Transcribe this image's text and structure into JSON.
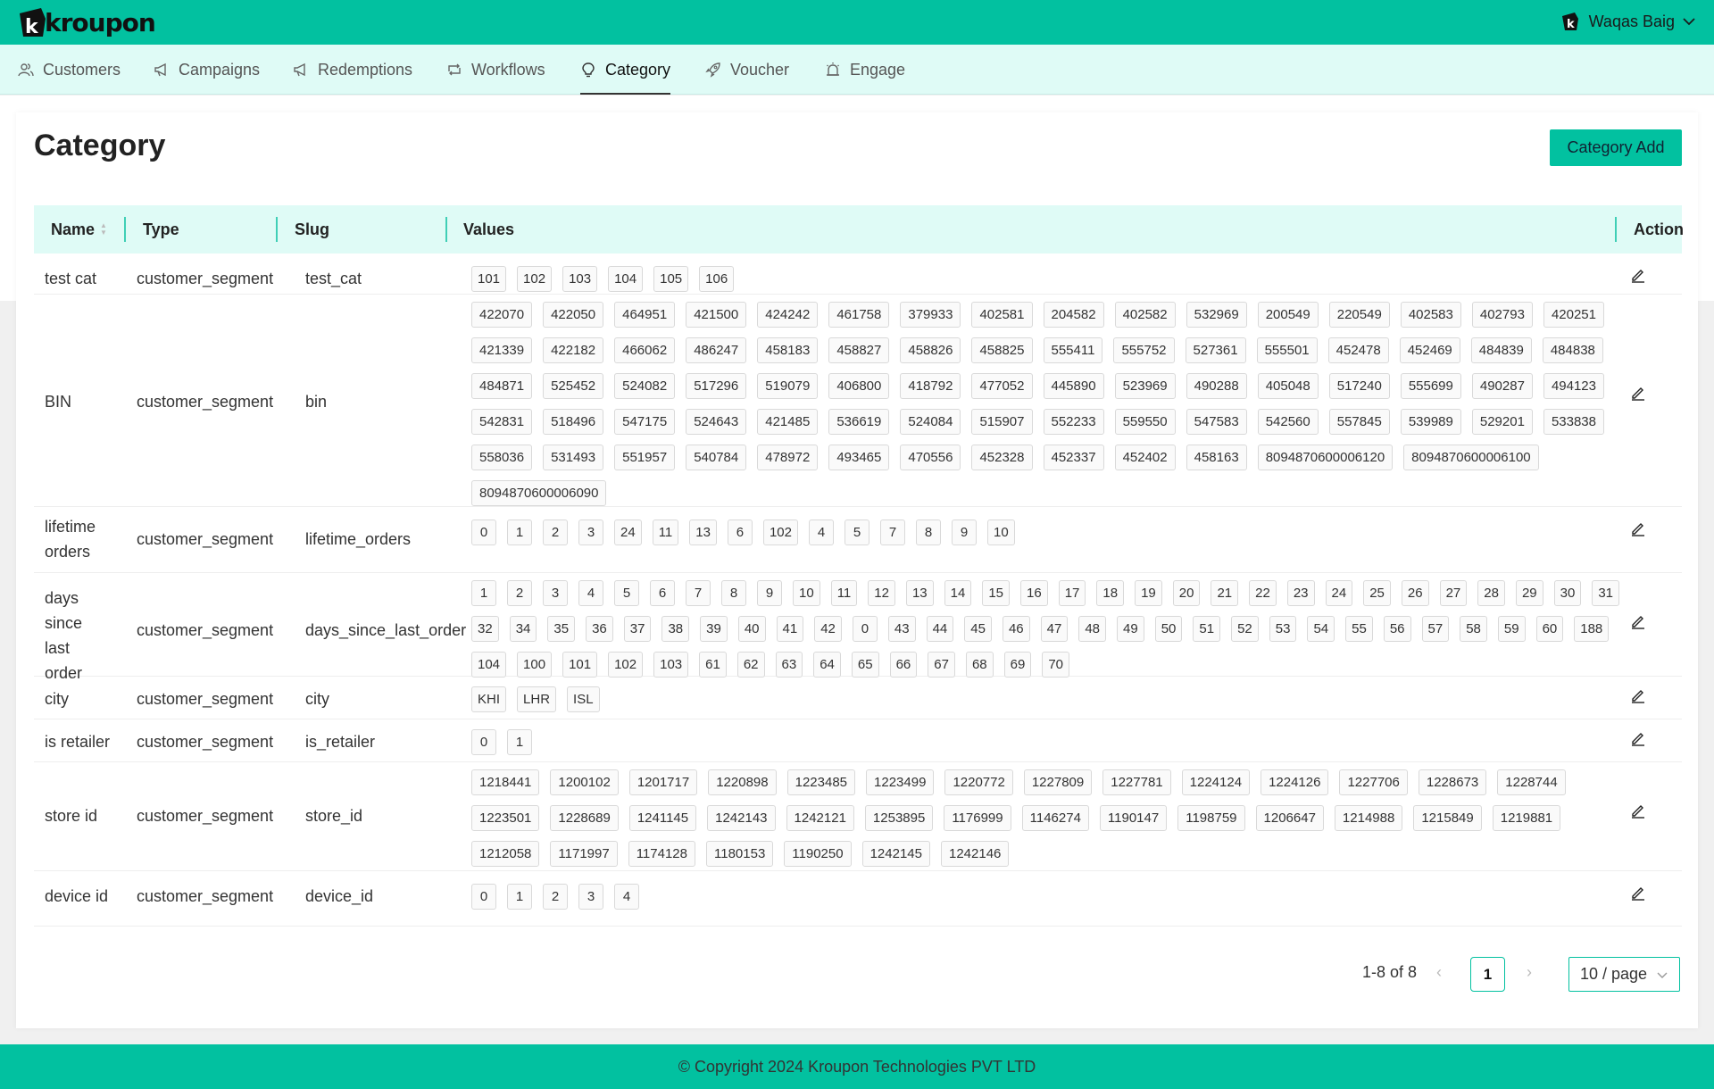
{
  "header": {
    "logo_text": "kroupon",
    "user_name": "Waqas Baig"
  },
  "nav": {
    "items": [
      {
        "label": "Customers"
      },
      {
        "label": "Campaigns"
      },
      {
        "label": "Redemptions"
      },
      {
        "label": "Workflows"
      },
      {
        "label": "Category"
      },
      {
        "label": "Voucher"
      },
      {
        "label": "Engage"
      }
    ],
    "active": "Category"
  },
  "page": {
    "title": "Category",
    "add_button": "Category Add"
  },
  "table": {
    "columns": {
      "name": "Name",
      "type": "Type",
      "slug": "Slug",
      "values": "Values",
      "action": "Action"
    },
    "rows": [
      {
        "name": "test cat",
        "type": "customer_segment",
        "slug": "test_cat",
        "values": [
          "101",
          "102",
          "103",
          "104",
          "105",
          "106"
        ]
      },
      {
        "name": "BIN",
        "type": "customer_segment",
        "slug": "bin",
        "values": [
          "422070",
          "422050",
          "464951",
          "421500",
          "424242",
          "461758",
          "379933",
          "402581",
          "204582",
          "402582",
          "532969",
          "200549",
          "220549",
          "402583",
          "402793",
          "420251",
          "421339",
          "422182",
          "466062",
          "486247",
          "458183",
          "458827",
          "458826",
          "458825",
          "555411",
          "555752",
          "527361",
          "555501",
          "452478",
          "452469",
          "484839",
          "484838",
          "484871",
          "525452",
          "524082",
          "517296",
          "519079",
          "406800",
          "418792",
          "477052",
          "445890",
          "523969",
          "490288",
          "405048",
          "517240",
          "555699",
          "490287",
          "494123",
          "542831",
          "518496",
          "547175",
          "524643",
          "421485",
          "536619",
          "524084",
          "515907",
          "552233",
          "559550",
          "547583",
          "542560",
          "557845",
          "539989",
          "529201",
          "533838",
          "558036",
          "531493",
          "551957",
          "540784",
          "478972",
          "493465",
          "470556",
          "452328",
          "452337",
          "452402",
          "458163",
          "8094870600006120",
          "8094870600006100",
          "8094870600006090"
        ]
      },
      {
        "name": "lifetime orders",
        "type": "customer_segment",
        "slug": "lifetime_orders",
        "values": [
          "0",
          "1",
          "2",
          "3",
          "24",
          "11",
          "13",
          "6",
          "102",
          "4",
          "5",
          "7",
          "8",
          "9",
          "10"
        ]
      },
      {
        "name": "days since last order",
        "type": "customer_segment",
        "slug": "days_since_last_order",
        "values": [
          "1",
          "2",
          "3",
          "4",
          "5",
          "6",
          "7",
          "8",
          "9",
          "10",
          "11",
          "12",
          "13",
          "14",
          "15",
          "16",
          "17",
          "18",
          "19",
          "20",
          "21",
          "22",
          "23",
          "24",
          "25",
          "26",
          "27",
          "28",
          "29",
          "30",
          "31",
          "32",
          "34",
          "35",
          "36",
          "37",
          "38",
          "39",
          "40",
          "41",
          "42",
          "0",
          "43",
          "44",
          "45",
          "46",
          "47",
          "48",
          "49",
          "50",
          "51",
          "52",
          "53",
          "54",
          "55",
          "56",
          "57",
          "58",
          "59",
          "60",
          "188",
          "104",
          "100",
          "101",
          "102",
          "103",
          "61",
          "62",
          "63",
          "64",
          "65",
          "66",
          "67",
          "68",
          "69",
          "70"
        ]
      },
      {
        "name": "city",
        "type": "customer_segment",
        "slug": "city",
        "values": [
          "KHI",
          "LHR",
          "ISL"
        ]
      },
      {
        "name": "is retailer",
        "type": "customer_segment",
        "slug": "is_retailer",
        "values": [
          "0",
          "1"
        ]
      },
      {
        "name": "store id",
        "type": "customer_segment",
        "slug": "store_id",
        "values": [
          "1218441",
          "1200102",
          "1201717",
          "1220898",
          "1223485",
          "1223499",
          "1220772",
          "1227809",
          "1227781",
          "1224124",
          "1224126",
          "1227706",
          "1228673",
          "1228744",
          "1223501",
          "1228689",
          "1241145",
          "1242143",
          "1242121",
          "1253895",
          "1176999",
          "1146274",
          "1190147",
          "1198759",
          "1206647",
          "1214988",
          "1215849",
          "1219881",
          "1212058",
          "1171997",
          "1174128",
          "1180153",
          "1190250",
          "1242145",
          "1242146"
        ]
      },
      {
        "name": "device id",
        "type": "customer_segment",
        "slug": "device_id",
        "values": [
          "0",
          "1",
          "2",
          "3",
          "4"
        ]
      }
    ]
  },
  "pagination": {
    "total_text": "1-8 of 8",
    "current_page": "1",
    "page_size": "10 / page"
  },
  "footer": {
    "text": "© Copyright 2024 Kroupon Technologies PVT LTD"
  },
  "colors": {
    "brand": "#02c1a0",
    "nav_bg": "#dffbf6"
  }
}
